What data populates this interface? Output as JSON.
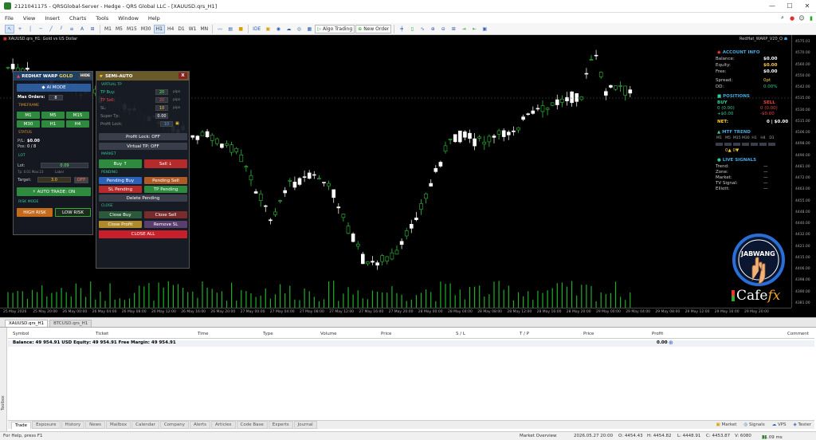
{
  "window": {
    "title": "2121041175 - QRSGlobal-Server - Hedge - QRS Global LLC - [XAUUSD.qrs_H1]",
    "minimize": "—",
    "maximize": "☐",
    "close": "✕"
  },
  "menu": [
    "File",
    "View",
    "Insert",
    "Charts",
    "Tools",
    "Window",
    "Help"
  ],
  "menu_right_icons": [
    "search-icon",
    "notifications-icon",
    "user-icon",
    "battery-icon"
  ],
  "toolbar": {
    "timeframes": [
      "M1",
      "M5",
      "M15",
      "M30",
      "H1",
      "H4",
      "D1",
      "W1",
      "MN"
    ],
    "active_timeframe": "H1",
    "ide": "IDE",
    "algo_trading": "Algo Trading",
    "new_order": "New Order"
  },
  "chart": {
    "symbol_label": "XAUUSD.qrs_H1: Gold vs US Dollar",
    "ea_label": "RedHat_WARP_V20_Q",
    "price_axis": [
      "4575.01",
      "4570.00",
      "4560.00",
      "4550.00",
      "4542.00",
      "4535.00",
      "4530.00",
      "4515.00",
      "4506.00",
      "4498.00",
      "4490.00",
      "4481.00",
      "4472.00",
      "4463.00",
      "4455.00",
      "4448.00",
      "4440.00",
      "4432.00",
      "4421.00",
      "4415.00",
      "4406.00",
      "4398.00",
      "4390.00",
      "4381.00"
    ],
    "time_axis": [
      "25 May 2026",
      "25 May 20:00",
      "26 May 00:00",
      "26 May 04:00",
      "26 May 08:00",
      "26 May 12:00",
      "26 May 16:00",
      "26 May 20:00",
      "27 May 00:00",
      "27 May 04:00",
      "27 May 08:00",
      "27 May 12:00",
      "27 May 16:00",
      "27 May 20:00",
      "28 May 00:00",
      "28 May 04:00",
      "28 May 08:00",
      "28 May 12:00",
      "28 May 16:00",
      "28 May 20:00",
      "29 May 00:00",
      "29 May 04:00",
      "29 May 08:00",
      "29 May 12:00",
      "29 May 16:00",
      "29 May 20:00"
    ]
  },
  "redhat_panel": {
    "title": "REDHAT WARP",
    "title_gold": "GOLD",
    "hide": "HIDE",
    "ai_mode": "AI MODE",
    "max_orders_label": "Max Orders:",
    "max_orders_value": "8",
    "timeframe_section": "TIMEFRAME",
    "tf_buttons": [
      "M1",
      "M5",
      "M15",
      "M30",
      "H1",
      "H4"
    ],
    "status_section": "STATUS",
    "pnl_label": "P/L:",
    "pnl_value": "$0.00",
    "pos_label": "Pos:",
    "pos_value": "0 / 8",
    "lot_section": "LOT",
    "lot_label": "Lot:",
    "lot_value": "0.09",
    "lot_hint": "Tp: 0.01 Max:23",
    "lot_hint2": "Label",
    "target_label": "Target:",
    "target_value": "3.0",
    "off": "OFF",
    "auto_trade": "AUTO TRADE: ON",
    "risk_section": "RISK MODE",
    "high_risk": "HIGH RISK",
    "low_risk": "LOW RISK"
  },
  "semi_panel": {
    "title": "SEMI-AUTO",
    "close": "X",
    "virtual_section": "VIRTUAL TP",
    "rows": [
      {
        "label": "TP Buy:",
        "value": "20",
        "unit": "pips"
      },
      {
        "label": "TP Sell:",
        "value": "20",
        "unit": "pips"
      },
      {
        "label": "SL:",
        "value": "10",
        "unit": "pips"
      },
      {
        "label": "Super Tp:",
        "value": "0.00",
        "unit": ""
      },
      {
        "label": "Profit Lock:",
        "value": "10",
        "unit": ""
      }
    ],
    "profit_lock": "Profit Lock: OFF",
    "virtual_tp": "Virtual TP: OFF",
    "market_section": "MARKET",
    "buy": "Buy ↑",
    "sell": "Sell ↓",
    "pending_section": "PENDING",
    "pending_buy": "Pending Buy",
    "pending_sell": "Pending Sell",
    "sl_pending": "SL Pending",
    "tp_pending": "TP Pending",
    "delete_pending": "Delete Pending",
    "close_section": "CLOSE",
    "close_buy": "Close Buy",
    "close_sell": "Close Sell",
    "close_profit": "Close Profit",
    "remove_sl": "Remove SL",
    "close_all": "CLOSE ALL"
  },
  "account_info": {
    "title": "ACCOUNT INFO",
    "rows": [
      {
        "label": "Balance:",
        "value": "$0.00"
      },
      {
        "label": "Equity:",
        "value": "$0.00"
      },
      {
        "label": "Free:",
        "value": "$0.00"
      }
    ],
    "spread_label": "Spread:",
    "spread_value": "0pt",
    "dd_label": "DD:",
    "dd_value": "0.00%",
    "positions_title": "POSITIONS",
    "buy_label": "BUY",
    "buy_count": "0 (0.00)",
    "buy_pnl": "+$0.00",
    "sell_label": "SELL",
    "sell_count": "0 (0.00)",
    "sell_pnl": "-$0.00",
    "net_label": "NET:",
    "net_value": "0 | $0.00",
    "mtf_title": "MTF TREND",
    "mtf_tfs": [
      "M1",
      "M5",
      "M15",
      "M30",
      "H1",
      "H4",
      "D1"
    ],
    "mtf_summary": "0▲ 0▼",
    "signals_title": "LIVE SIGNALS",
    "signals": [
      {
        "label": "Trend:",
        "value": "—"
      },
      {
        "label": "Zone:",
        "value": "—"
      },
      {
        "label": "Market:",
        "value": "—"
      },
      {
        "label": "TV Signal:",
        "value": "—"
      },
      {
        "label": "Elliott:",
        "value": "—"
      }
    ]
  },
  "logo": {
    "circle_text": "JABWANG",
    "brand": "Cafe",
    "brand_fx": "fx"
  },
  "chart_tabs": [
    {
      "label": "XAUUSD.qrs_H1",
      "active": true
    },
    {
      "label": "BTCUSD.qrs_H1",
      "active": false
    }
  ],
  "terminal": {
    "side_label": "Toolbox",
    "columns": [
      "Symbol",
      "Ticket",
      "Time",
      "Type",
      "Volume",
      "Price",
      "S / L",
      "T / P",
      "Price",
      "Profit",
      "Comment"
    ],
    "balance_text": "Balance: 49 954.91 USD  Equity: 49 954.91  Free Margin: 49 954.91",
    "balance_profit": "0.00",
    "tabs": [
      {
        "label": "Trade",
        "active": true
      },
      {
        "label": "Exposure"
      },
      {
        "label": "History"
      },
      {
        "label": "News"
      },
      {
        "label": "Mailbox"
      },
      {
        "label": "Calendar"
      },
      {
        "label": "Company"
      },
      {
        "label": "Alerts"
      },
      {
        "label": "Articles"
      },
      {
        "label": "Code Base"
      },
      {
        "label": "Experts"
      },
      {
        "label": "Journal"
      }
    ],
    "right_items": [
      "Market",
      "Signals",
      "VPS",
      "Tester"
    ]
  },
  "statusbar": {
    "help": "For Help, press F1",
    "overview": "Market Overview",
    "datetime": "2026.05.27 20:00",
    "o": "O: 4454.43",
    "h": "H: 4454.82",
    "l": "L: 4448.91",
    "c": "C: 4453.87",
    "v": "V: 6080",
    "conn": "31.09 ms"
  }
}
